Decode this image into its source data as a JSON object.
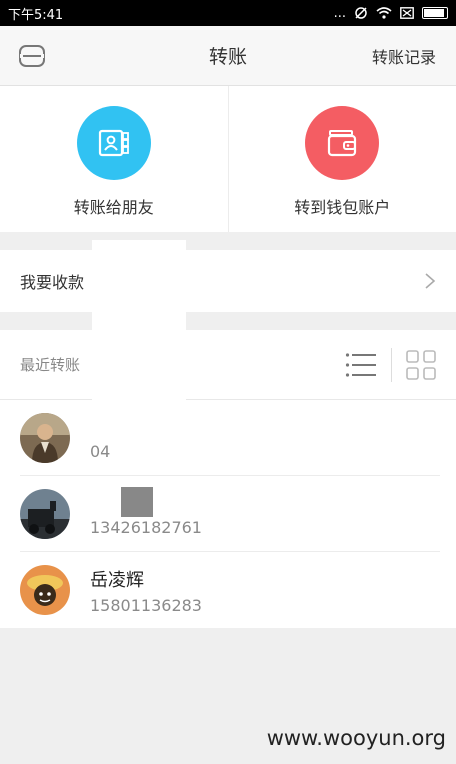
{
  "status_bar": {
    "time": "下午5:41",
    "more": "...",
    "battery": "battery-icon"
  },
  "header": {
    "title": "转账",
    "history_label": "转账记录"
  },
  "actions": [
    {
      "label": "转账给朋友",
      "icon": "contact-card-icon",
      "color": "#31c2f2"
    },
    {
      "label": "转到钱包账户",
      "icon": "wallet-icon",
      "color": "#f45d63"
    }
  ],
  "receive": {
    "label": "我要收款"
  },
  "recent": {
    "label": "最近转账",
    "contacts": [
      {
        "name": "",
        "phone": "04"
      },
      {
        "name": "",
        "phone": "13426182761"
      },
      {
        "name": "岳凌辉",
        "phone": "15801136283"
      }
    ]
  },
  "watermark": "www.wooyun.org"
}
